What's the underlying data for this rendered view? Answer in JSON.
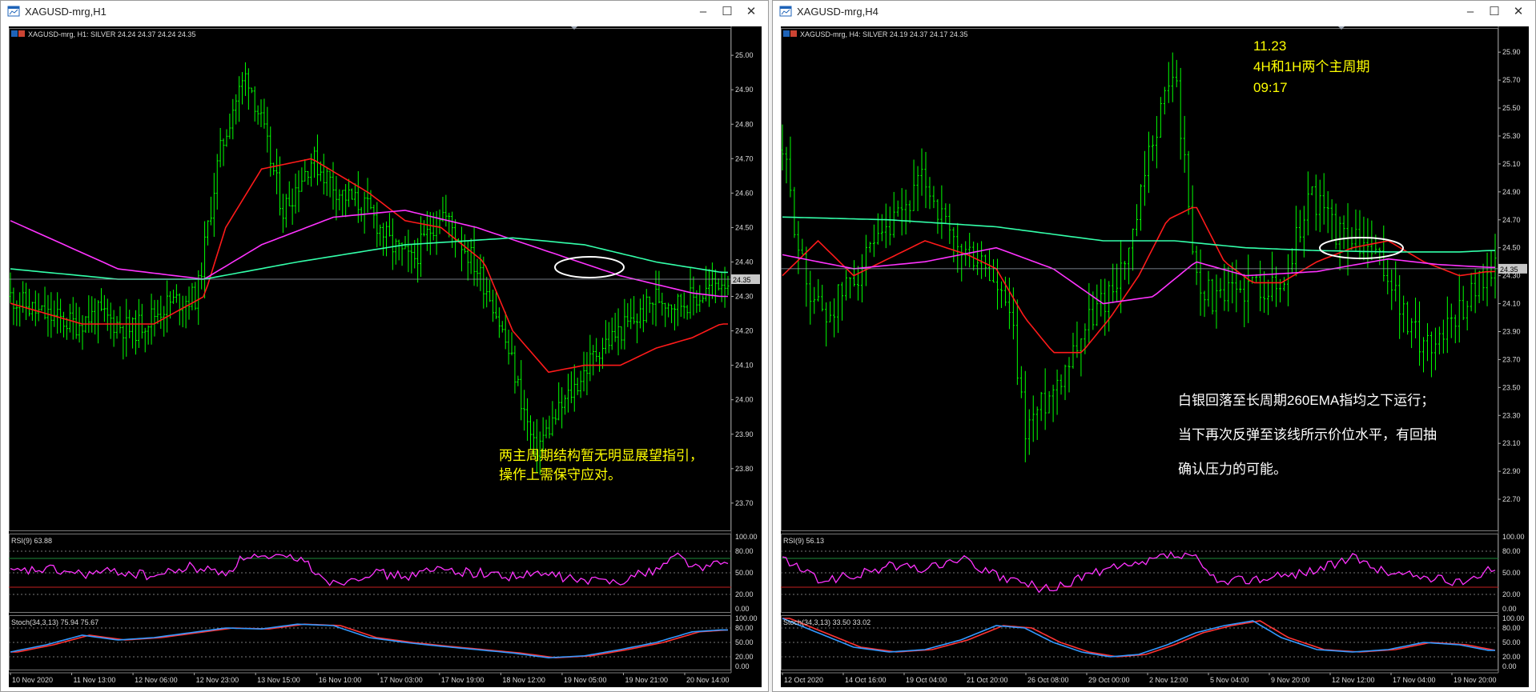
{
  "windows": [
    {
      "title": "XAGUSD-mrg,H1",
      "header": "XAGUSD-mrg, H1:  SILVER  24.24 24.37 24.24 24.35",
      "price_badge": "24.35",
      "rsi_label": "RSI(9) 63.88",
      "stoch_label": "Stoch(34,3,13) 75.94 75.67",
      "annotation": [
        "两主周期结构暂无明显展望指引，",
        "操作上需保守应对。"
      ]
    },
    {
      "title": "XAGUSD-mrg,H4",
      "header": "XAGUSD-mrg, H4:  SILVER  24.19 24.37 24.17 24.35",
      "price_badge": "24.35",
      "rsi_label": "RSI(9) 56.13",
      "stoch_label": "Stoch(34,3,13) 33.50 33.02",
      "annotation_top": [
        "11.23",
        "4H和1H两个主周期",
        "09:17"
      ],
      "annotation": [
        "白银回落至长周期260EMA指均之下运行；",
        "当下再次反弹至该线所示价位水平，有回抽",
        "确认压力的可能。"
      ]
    }
  ],
  "chart_data": [
    {
      "type": "line",
      "title": "XAGUSD-mrg, H1",
      "ylim": [
        23.63,
        25.07
      ],
      "y_ticks": [
        "25.00",
        "24.90",
        "24.80",
        "24.70",
        "24.60",
        "24.50",
        "24.40",
        "24.30",
        "24.20",
        "24.10",
        "24.00",
        "23.90",
        "23.80",
        "23.70"
      ],
      "x_ticks": [
        "10 Nov 2020",
        "11 Nov 13:00",
        "12 Nov 06:00",
        "12 Nov 23:00",
        "13 Nov 15:00",
        "16 Nov 10:00",
        "17 Nov 03:00",
        "17 Nov 19:00",
        "18 Nov 12:00",
        "19 Nov 05:00",
        "19 Nov 21:00",
        "20 Nov 14:00"
      ],
      "last_price": 24.35,
      "series": [
        {
          "role": "price",
          "color": "#00ff00",
          "x": [
            0,
            0.04,
            0.09,
            0.12,
            0.17,
            0.22,
            0.26,
            0.29,
            0.31,
            0.33,
            0.35,
            0.38,
            0.42,
            0.46,
            0.5,
            0.53,
            0.56,
            0.6,
            0.64,
            0.67,
            0.7,
            0.73,
            0.76,
            0.79,
            0.82,
            0.85,
            0.88,
            0.9,
            0.93,
            0.96,
            0.99
          ],
          "values": [
            24.3,
            24.25,
            24.22,
            24.25,
            24.2,
            24.28,
            24.3,
            24.7,
            24.85,
            24.95,
            24.8,
            24.55,
            24.7,
            24.6,
            24.55,
            24.45,
            24.4,
            24.55,
            24.42,
            24.3,
            24.1,
            23.85,
            23.95,
            24.05,
            24.15,
            24.2,
            24.25,
            24.3,
            24.28,
            24.3,
            24.35
          ]
        },
        {
          "role": "ema-fast",
          "color": "#ff1a1a",
          "x": [
            0,
            0.1,
            0.2,
            0.27,
            0.3,
            0.35,
            0.42,
            0.5,
            0.55,
            0.6,
            0.66,
            0.7,
            0.75,
            0.8,
            0.85,
            0.9,
            0.95,
            0.99
          ],
          "values": [
            24.28,
            24.22,
            24.22,
            24.3,
            24.5,
            24.67,
            24.7,
            24.6,
            24.52,
            24.5,
            24.4,
            24.2,
            24.08,
            24.1,
            24.1,
            24.15,
            24.18,
            24.22
          ]
        },
        {
          "role": "ema-mid",
          "color": "#ff33ff",
          "x": [
            0,
            0.15,
            0.27,
            0.35,
            0.45,
            0.55,
            0.65,
            0.75,
            0.85,
            0.95,
            0.99
          ],
          "values": [
            24.52,
            24.38,
            24.35,
            24.45,
            24.53,
            24.55,
            24.5,
            24.43,
            24.36,
            24.31,
            24.3
          ]
        },
        {
          "role": "ema-long",
          "color": "#33ffaa",
          "x": [
            0,
            0.15,
            0.27,
            0.4,
            0.55,
            0.7,
            0.8,
            0.9,
            0.99
          ],
          "values": [
            24.38,
            24.35,
            24.35,
            24.4,
            24.45,
            24.47,
            24.45,
            24.4,
            24.37
          ]
        }
      ],
      "rsi": {
        "ylim": [
          0,
          100
        ],
        "ticks": [
          "100.00",
          "80.00",
          "50.00",
          "20.00",
          "0.00"
        ],
        "levels": [
          70,
          30
        ],
        "color": "#ff33ff",
        "x": [
          0,
          0.05,
          0.1,
          0.15,
          0.2,
          0.25,
          0.3,
          0.33,
          0.36,
          0.4,
          0.45,
          0.5,
          0.55,
          0.6,
          0.65,
          0.7,
          0.75,
          0.8,
          0.85,
          0.9,
          0.93,
          0.96,
          0.99
        ],
        "values": [
          50,
          55,
          48,
          52,
          45,
          58,
          50,
          75,
          68,
          72,
          35,
          50,
          45,
          55,
          50,
          45,
          48,
          38,
          40,
          55,
          75,
          55,
          63.88
        ]
      },
      "stoch": {
        "ylim": [
          0,
          100
        ],
        "ticks": [
          "100.00",
          "80.00",
          "50.00",
          "20.00",
          "0.00"
        ],
        "main_color": "#3399ff",
        "signal_color": "#ff3333",
        "x": [
          0,
          0.05,
          0.1,
          0.15,
          0.2,
          0.25,
          0.3,
          0.35,
          0.4,
          0.45,
          0.5,
          0.55,
          0.6,
          0.65,
          0.7,
          0.75,
          0.8,
          0.85,
          0.9,
          0.95,
          0.99
        ],
        "values": [
          30,
          45,
          65,
          55,
          60,
          70,
          80,
          78,
          88,
          85,
          60,
          50,
          42,
          35,
          28,
          18,
          22,
          35,
          50,
          72,
          75.94
        ]
      }
    },
    {
      "type": "line",
      "title": "XAGUSD-mrg, H4",
      "ylim": [
        22.5,
        26.05
      ],
      "y_ticks": [
        "25.90",
        "25.70",
        "25.50",
        "25.30",
        "25.10",
        "24.90",
        "24.70",
        "24.50",
        "24.30",
        "24.10",
        "23.90",
        "23.70",
        "23.50",
        "23.30",
        "23.10",
        "22.90",
        "22.70"
      ],
      "x_ticks": [
        "12 Oct 2020",
        "14 Oct 16:00",
        "19 Oct 04:00",
        "21 Oct 20:00",
        "26 Oct 08:00",
        "29 Oct 00:00",
        "2 Nov 12:00",
        "5 Nov 04:00",
        "9 Nov 20:00",
        "12 Nov 12:00",
        "17 Nov 04:00",
        "19 Nov 20:00"
      ],
      "last_price": 24.35,
      "series": [
        {
          "role": "price",
          "color": "#00ff00",
          "x": [
            0,
            0.03,
            0.06,
            0.1,
            0.15,
            0.2,
            0.24,
            0.28,
            0.32,
            0.34,
            0.38,
            0.42,
            0.46,
            0.49,
            0.52,
            0.55,
            0.58,
            0.61,
            0.64,
            0.67,
            0.7,
            0.74,
            0.78,
            0.82,
            0.85,
            0.88,
            0.91,
            0.94,
            0.97,
            0.99
          ],
          "values": [
            25.2,
            24.3,
            24.0,
            24.3,
            24.6,
            25.0,
            24.5,
            24.4,
            24.0,
            23.2,
            23.5,
            23.9,
            24.2,
            24.5,
            25.3,
            25.8,
            24.3,
            24.1,
            24.2,
            24.25,
            24.2,
            24.9,
            24.6,
            24.5,
            24.3,
            23.9,
            23.8,
            24.0,
            24.2,
            24.35
          ]
        },
        {
          "role": "ema-fast",
          "color": "#ff1a1a",
          "x": [
            0,
            0.05,
            0.1,
            0.16,
            0.2,
            0.26,
            0.3,
            0.34,
            0.38,
            0.42,
            0.46,
            0.5,
            0.54,
            0.58,
            0.62,
            0.66,
            0.7,
            0.75,
            0.8,
            0.85,
            0.9,
            0.95,
            0.99
          ],
          "values": [
            24.3,
            24.55,
            24.3,
            24.45,
            24.55,
            24.45,
            24.35,
            24.0,
            23.75,
            23.75,
            24.0,
            24.3,
            24.7,
            24.8,
            24.4,
            24.25,
            24.25,
            24.4,
            24.5,
            24.55,
            24.4,
            24.3,
            24.33
          ]
        },
        {
          "role": "ema-mid",
          "color": "#ff33ff",
          "x": [
            0,
            0.1,
            0.2,
            0.3,
            0.38,
            0.45,
            0.52,
            0.58,
            0.65,
            0.75,
            0.85,
            0.92,
            0.99
          ],
          "values": [
            24.45,
            24.35,
            24.4,
            24.5,
            24.35,
            24.1,
            24.15,
            24.4,
            24.3,
            24.33,
            24.42,
            24.38,
            24.36
          ]
        },
        {
          "role": "ema-long",
          "color": "#33ffaa",
          "x": [
            0,
            0.15,
            0.3,
            0.45,
            0.55,
            0.65,
            0.75,
            0.85,
            0.95,
            0.99
          ],
          "values": [
            24.72,
            24.7,
            24.65,
            24.55,
            24.55,
            24.5,
            24.48,
            24.47,
            24.47,
            24.48
          ]
        }
      ],
      "rsi": {
        "ylim": [
          0,
          100
        ],
        "ticks": [
          "100.00",
          "80.00",
          "50.00",
          "20.00",
          "0.00"
        ],
        "levels": [
          70,
          30
        ],
        "color": "#ff33ff",
        "x": [
          0,
          0.05,
          0.1,
          0.15,
          0.2,
          0.25,
          0.3,
          0.34,
          0.38,
          0.42,
          0.46,
          0.5,
          0.54,
          0.58,
          0.61,
          0.64,
          0.7,
          0.75,
          0.8,
          0.85,
          0.9,
          0.95,
          0.99
        ],
        "values": [
          70,
          40,
          45,
          60,
          55,
          70,
          45,
          35,
          25,
          45,
          55,
          60,
          75,
          70,
          35,
          40,
          45,
          55,
          70,
          50,
          45,
          35,
          56.13
        ]
      },
      "stoch": {
        "ylim": [
          0,
          100
        ],
        "ticks": [
          "100.00",
          "80.00",
          "50.00",
          "20.00",
          "0.00"
        ],
        "main_color": "#3399ff",
        "signal_color": "#ff3333",
        "x": [
          0,
          0.05,
          0.1,
          0.15,
          0.2,
          0.25,
          0.3,
          0.34,
          0.38,
          0.42,
          0.46,
          0.5,
          0.54,
          0.58,
          0.62,
          0.66,
          0.7,
          0.75,
          0.8,
          0.85,
          0.9,
          0.95,
          0.99
        ],
        "values": [
          100,
          70,
          40,
          30,
          35,
          55,
          85,
          80,
          50,
          30,
          20,
          25,
          45,
          70,
          85,
          95,
          60,
          35,
          30,
          35,
          50,
          45,
          33.5
        ]
      }
    }
  ]
}
